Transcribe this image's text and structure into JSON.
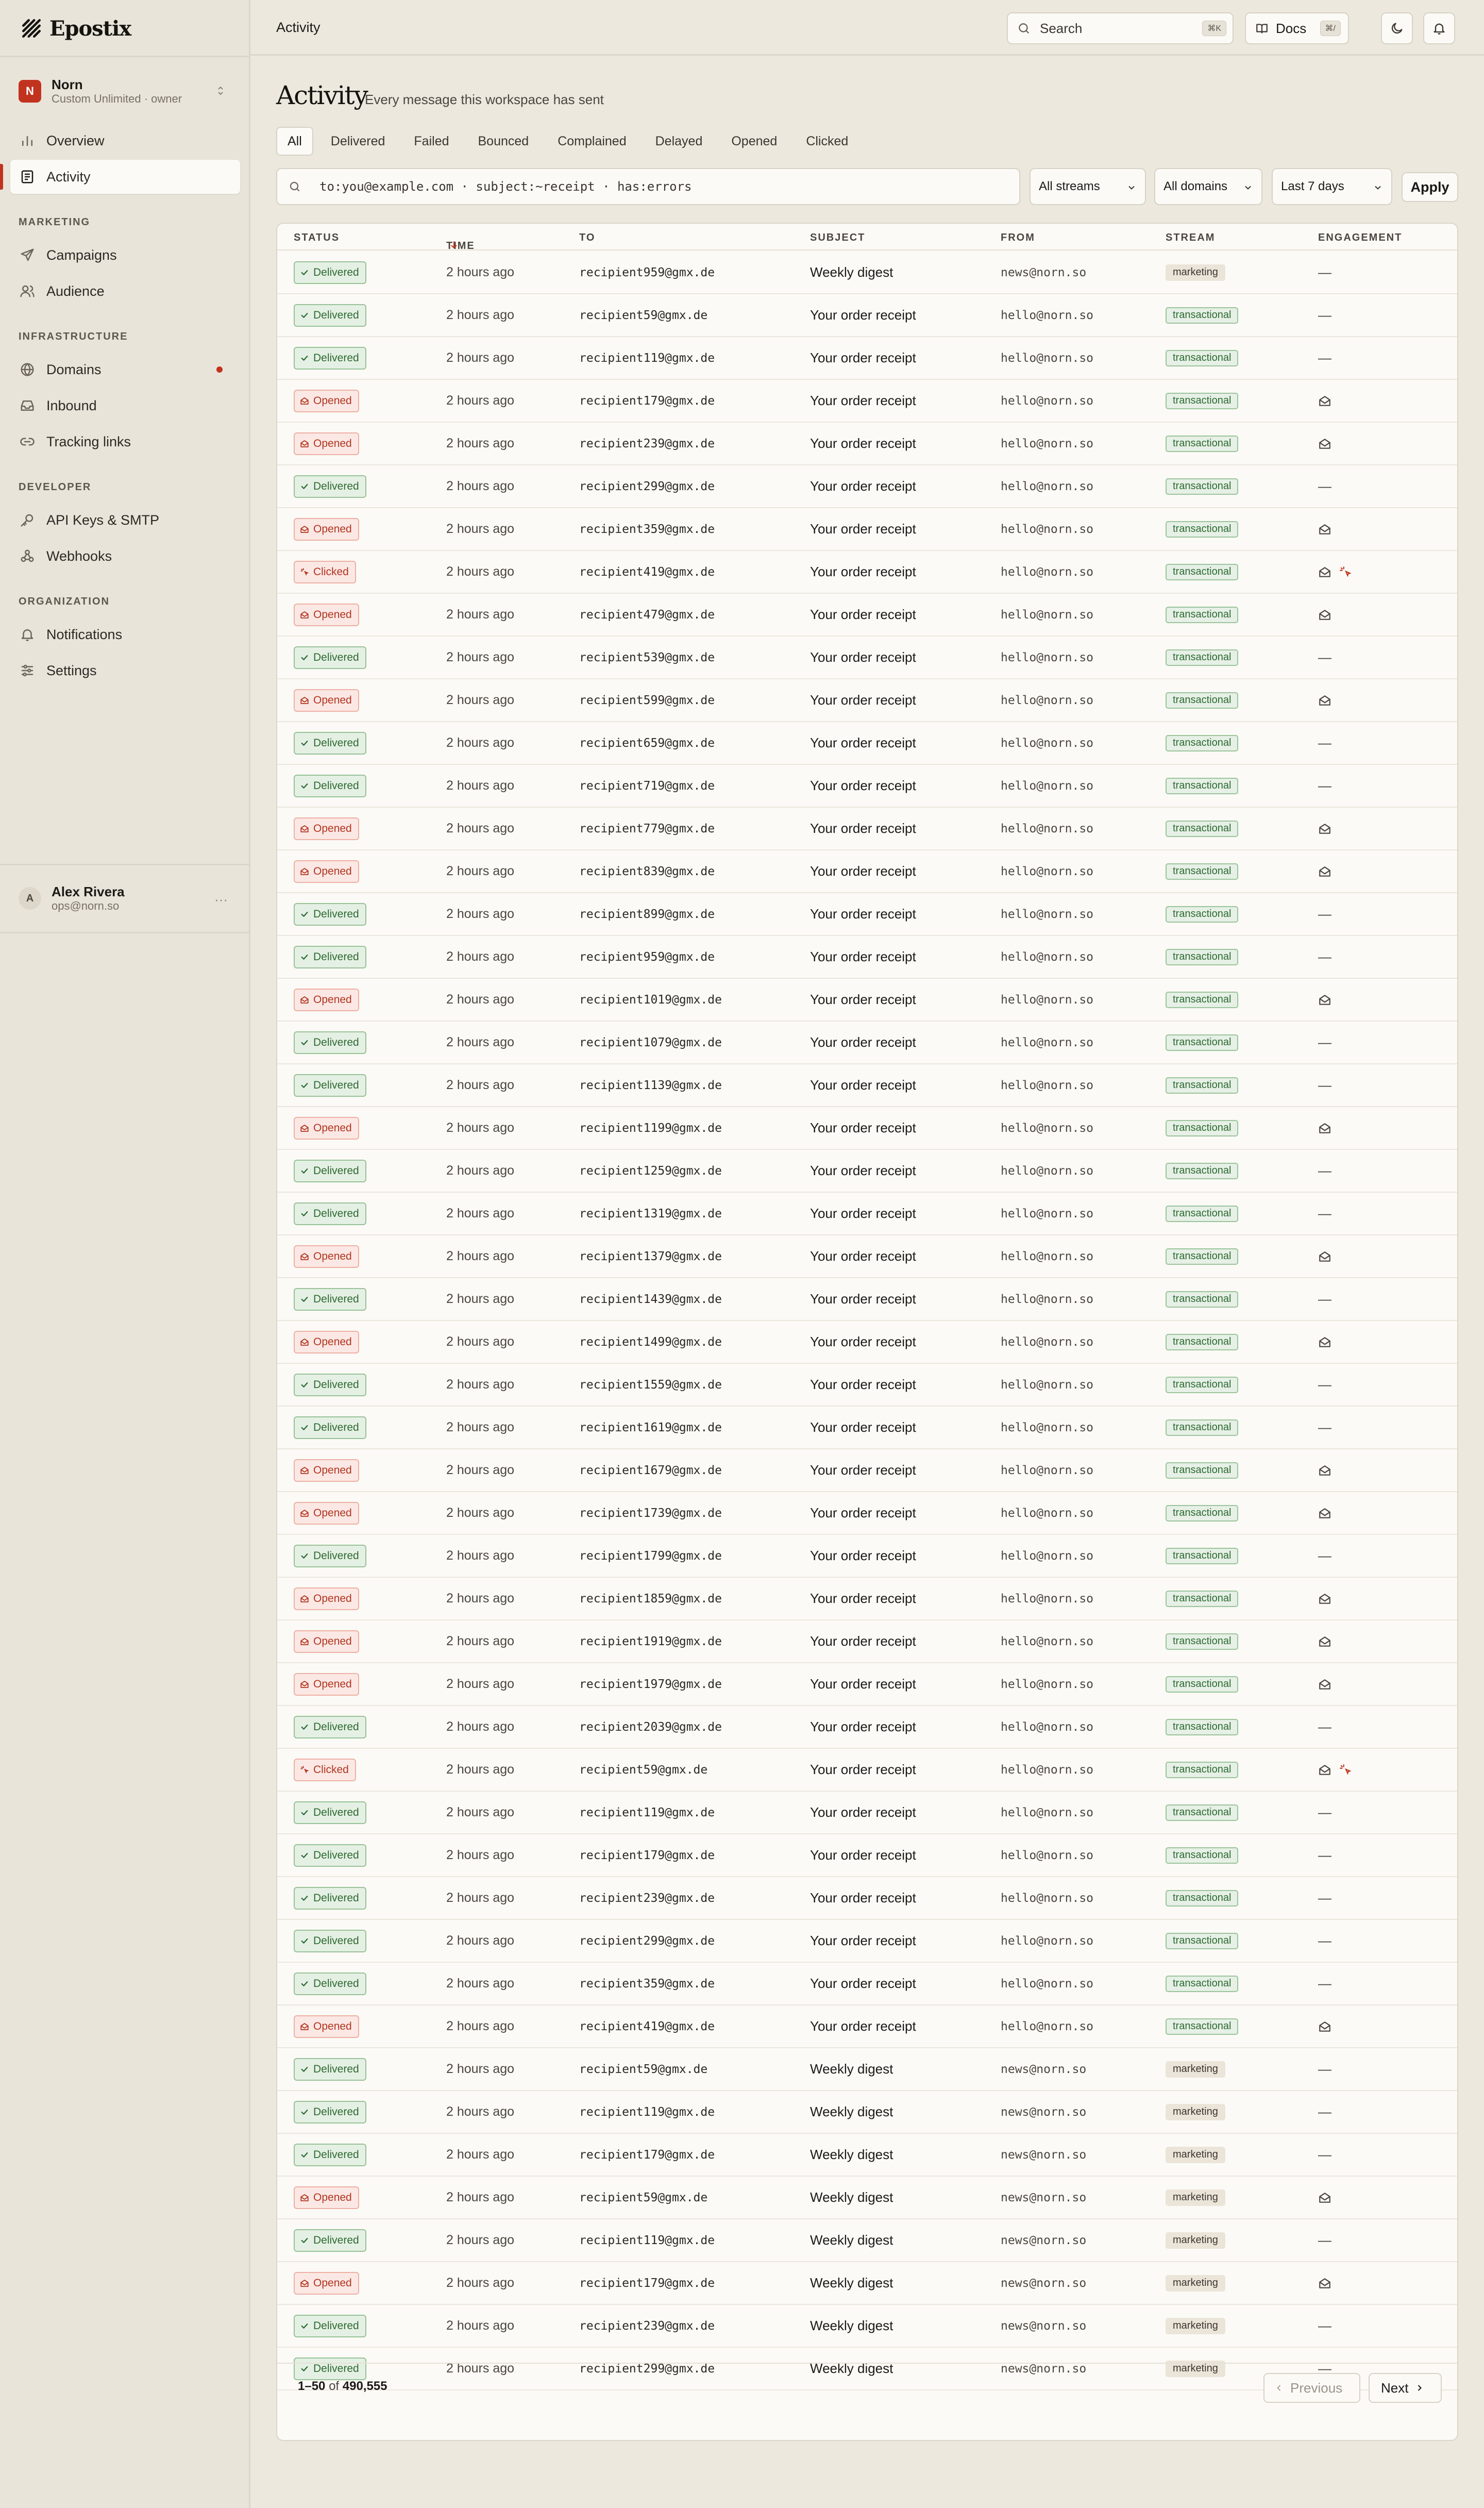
{
  "app": {
    "name": "Epostix"
  },
  "workspace": {
    "avatar": "N",
    "name": "Norn",
    "plan": "Custom Unlimited · owner"
  },
  "nav": {
    "overview": "Overview",
    "activity": "Activity",
    "marketing_title": "MARKETING",
    "campaigns": "Campaigns",
    "audience": "Audience",
    "infra_title": "INFRASTRUCTURE",
    "domains": "Domains",
    "inbound": "Inbound",
    "tracking": "Tracking links",
    "dev_title": "DEVELOPER",
    "apikeys": "API Keys & SMTP",
    "webhooks": "Webhooks",
    "org_title": "ORGANIZATION",
    "notifications": "Notifications",
    "settings": "Settings"
  },
  "user": {
    "avatar": "A",
    "name": "Alex Rivera",
    "email": "ops@norn.so",
    "more": "···"
  },
  "topbar": {
    "title": "Activity",
    "search_placeholder": "Search",
    "search_kbd": "⌘K",
    "docs_label": "Docs",
    "docs_kbd": "⌘/"
  },
  "page": {
    "title": "Activity",
    "subtitle": "Every message this workspace has sent"
  },
  "tabs": [
    "All",
    "Delivered",
    "Failed",
    "Bounced",
    "Complained",
    "Delayed",
    "Opened",
    "Clicked"
  ],
  "filter": {
    "query": "to:you@example.com · subject:~receipt · has:errors",
    "streams": "All streams",
    "domains": "All domains",
    "range": "Last 7 days",
    "apply": "Apply"
  },
  "table": {
    "headers": {
      "status": "STATUS",
      "time": "TIME",
      "to": "TO",
      "subject": "SUBJECT",
      "from": "FROM",
      "stream": "STREAM",
      "engagement": "ENGAGEMENT"
    },
    "rows": [
      {
        "status": "Delivered",
        "time": "2 hours ago",
        "to": "recipient959@gmx.de",
        "subject": "Weekly digest",
        "from": "news@norn.so",
        "stream": "marketing"
      },
      {
        "status": "Delivered",
        "time": "2 hours ago",
        "to": "recipient59@gmx.de",
        "subject": "Your order receipt",
        "from": "hello@norn.so",
        "stream": "transactional"
      },
      {
        "status": "Delivered",
        "time": "2 hours ago",
        "to": "recipient119@gmx.de",
        "subject": "Your order receipt",
        "from": "hello@norn.so",
        "stream": "transactional"
      },
      {
        "status": "Opened",
        "time": "2 hours ago",
        "to": "recipient179@gmx.de",
        "subject": "Your order receipt",
        "from": "hello@norn.so",
        "stream": "transactional"
      },
      {
        "status": "Opened",
        "time": "2 hours ago",
        "to": "recipient239@gmx.de",
        "subject": "Your order receipt",
        "from": "hello@norn.so",
        "stream": "transactional"
      },
      {
        "status": "Delivered",
        "time": "2 hours ago",
        "to": "recipient299@gmx.de",
        "subject": "Your order receipt",
        "from": "hello@norn.so",
        "stream": "transactional"
      },
      {
        "status": "Opened",
        "time": "2 hours ago",
        "to": "recipient359@gmx.de",
        "subject": "Your order receipt",
        "from": "hello@norn.so",
        "stream": "transactional"
      },
      {
        "status": "Clicked",
        "time": "2 hours ago",
        "to": "recipient419@gmx.de",
        "subject": "Your order receipt",
        "from": "hello@norn.so",
        "stream": "transactional"
      },
      {
        "status": "Opened",
        "time": "2 hours ago",
        "to": "recipient479@gmx.de",
        "subject": "Your order receipt",
        "from": "hello@norn.so",
        "stream": "transactional"
      },
      {
        "status": "Delivered",
        "time": "2 hours ago",
        "to": "recipient539@gmx.de",
        "subject": "Your order receipt",
        "from": "hello@norn.so",
        "stream": "transactional"
      },
      {
        "status": "Opened",
        "time": "2 hours ago",
        "to": "recipient599@gmx.de",
        "subject": "Your order receipt",
        "from": "hello@norn.so",
        "stream": "transactional"
      },
      {
        "status": "Delivered",
        "time": "2 hours ago",
        "to": "recipient659@gmx.de",
        "subject": "Your order receipt",
        "from": "hello@norn.so",
        "stream": "transactional"
      },
      {
        "status": "Delivered",
        "time": "2 hours ago",
        "to": "recipient719@gmx.de",
        "subject": "Your order receipt",
        "from": "hello@norn.so",
        "stream": "transactional"
      },
      {
        "status": "Opened",
        "time": "2 hours ago",
        "to": "recipient779@gmx.de",
        "subject": "Your order receipt",
        "from": "hello@norn.so",
        "stream": "transactional"
      },
      {
        "status": "Opened",
        "time": "2 hours ago",
        "to": "recipient839@gmx.de",
        "subject": "Your order receipt",
        "from": "hello@norn.so",
        "stream": "transactional"
      },
      {
        "status": "Delivered",
        "time": "2 hours ago",
        "to": "recipient899@gmx.de",
        "subject": "Your order receipt",
        "from": "hello@norn.so",
        "stream": "transactional"
      },
      {
        "status": "Delivered",
        "time": "2 hours ago",
        "to": "recipient959@gmx.de",
        "subject": "Your order receipt",
        "from": "hello@norn.so",
        "stream": "transactional"
      },
      {
        "status": "Opened",
        "time": "2 hours ago",
        "to": "recipient1019@gmx.de",
        "subject": "Your order receipt",
        "from": "hello@norn.so",
        "stream": "transactional"
      },
      {
        "status": "Delivered",
        "time": "2 hours ago",
        "to": "recipient1079@gmx.de",
        "subject": "Your order receipt",
        "from": "hello@norn.so",
        "stream": "transactional"
      },
      {
        "status": "Delivered",
        "time": "2 hours ago",
        "to": "recipient1139@gmx.de",
        "subject": "Your order receipt",
        "from": "hello@norn.so",
        "stream": "transactional"
      },
      {
        "status": "Opened",
        "time": "2 hours ago",
        "to": "recipient1199@gmx.de",
        "subject": "Your order receipt",
        "from": "hello@norn.so",
        "stream": "transactional"
      },
      {
        "status": "Delivered",
        "time": "2 hours ago",
        "to": "recipient1259@gmx.de",
        "subject": "Your order receipt",
        "from": "hello@norn.so",
        "stream": "transactional"
      },
      {
        "status": "Delivered",
        "time": "2 hours ago",
        "to": "recipient1319@gmx.de",
        "subject": "Your order receipt",
        "from": "hello@norn.so",
        "stream": "transactional"
      },
      {
        "status": "Opened",
        "time": "2 hours ago",
        "to": "recipient1379@gmx.de",
        "subject": "Your order receipt",
        "from": "hello@norn.so",
        "stream": "transactional"
      },
      {
        "status": "Delivered",
        "time": "2 hours ago",
        "to": "recipient1439@gmx.de",
        "subject": "Your order receipt",
        "from": "hello@norn.so",
        "stream": "transactional"
      },
      {
        "status": "Opened",
        "time": "2 hours ago",
        "to": "recipient1499@gmx.de",
        "subject": "Your order receipt",
        "from": "hello@norn.so",
        "stream": "transactional"
      },
      {
        "status": "Delivered",
        "time": "2 hours ago",
        "to": "recipient1559@gmx.de",
        "subject": "Your order receipt",
        "from": "hello@norn.so",
        "stream": "transactional"
      },
      {
        "status": "Delivered",
        "time": "2 hours ago",
        "to": "recipient1619@gmx.de",
        "subject": "Your order receipt",
        "from": "hello@norn.so",
        "stream": "transactional"
      },
      {
        "status": "Opened",
        "time": "2 hours ago",
        "to": "recipient1679@gmx.de",
        "subject": "Your order receipt",
        "from": "hello@norn.so",
        "stream": "transactional"
      },
      {
        "status": "Opened",
        "time": "2 hours ago",
        "to": "recipient1739@gmx.de",
        "subject": "Your order receipt",
        "from": "hello@norn.so",
        "stream": "transactional"
      },
      {
        "status": "Delivered",
        "time": "2 hours ago",
        "to": "recipient1799@gmx.de",
        "subject": "Your order receipt",
        "from": "hello@norn.so",
        "stream": "transactional"
      },
      {
        "status": "Opened",
        "time": "2 hours ago",
        "to": "recipient1859@gmx.de",
        "subject": "Your order receipt",
        "from": "hello@norn.so",
        "stream": "transactional"
      },
      {
        "status": "Opened",
        "time": "2 hours ago",
        "to": "recipient1919@gmx.de",
        "subject": "Your order receipt",
        "from": "hello@norn.so",
        "stream": "transactional"
      },
      {
        "status": "Opened",
        "time": "2 hours ago",
        "to": "recipient1979@gmx.de",
        "subject": "Your order receipt",
        "from": "hello@norn.so",
        "stream": "transactional"
      },
      {
        "status": "Delivered",
        "time": "2 hours ago",
        "to": "recipient2039@gmx.de",
        "subject": "Your order receipt",
        "from": "hello@norn.so",
        "stream": "transactional"
      },
      {
        "status": "Clicked",
        "time": "2 hours ago",
        "to": "recipient59@gmx.de",
        "subject": "Your order receipt",
        "from": "hello@norn.so",
        "stream": "transactional"
      },
      {
        "status": "Delivered",
        "time": "2 hours ago",
        "to": "recipient119@gmx.de",
        "subject": "Your order receipt",
        "from": "hello@norn.so",
        "stream": "transactional"
      },
      {
        "status": "Delivered",
        "time": "2 hours ago",
        "to": "recipient179@gmx.de",
        "subject": "Your order receipt",
        "from": "hello@norn.so",
        "stream": "transactional"
      },
      {
        "status": "Delivered",
        "time": "2 hours ago",
        "to": "recipient239@gmx.de",
        "subject": "Your order receipt",
        "from": "hello@norn.so",
        "stream": "transactional"
      },
      {
        "status": "Delivered",
        "time": "2 hours ago",
        "to": "recipient299@gmx.de",
        "subject": "Your order receipt",
        "from": "hello@norn.so",
        "stream": "transactional"
      },
      {
        "status": "Delivered",
        "time": "2 hours ago",
        "to": "recipient359@gmx.de",
        "subject": "Your order receipt",
        "from": "hello@norn.so",
        "stream": "transactional"
      },
      {
        "status": "Opened",
        "time": "2 hours ago",
        "to": "recipient419@gmx.de",
        "subject": "Your order receipt",
        "from": "hello@norn.so",
        "stream": "transactional"
      },
      {
        "status": "Delivered",
        "time": "2 hours ago",
        "to": "recipient59@gmx.de",
        "subject": "Weekly digest",
        "from": "news@norn.so",
        "stream": "marketing"
      },
      {
        "status": "Delivered",
        "time": "2 hours ago",
        "to": "recipient119@gmx.de",
        "subject": "Weekly digest",
        "from": "news@norn.so",
        "stream": "marketing"
      },
      {
        "status": "Delivered",
        "time": "2 hours ago",
        "to": "recipient179@gmx.de",
        "subject": "Weekly digest",
        "from": "news@norn.so",
        "stream": "marketing"
      },
      {
        "status": "Opened",
        "time": "2 hours ago",
        "to": "recipient59@gmx.de",
        "subject": "Weekly digest",
        "from": "news@norn.so",
        "stream": "marketing"
      },
      {
        "status": "Delivered",
        "time": "2 hours ago",
        "to": "recipient119@gmx.de",
        "subject": "Weekly digest",
        "from": "news@norn.so",
        "stream": "marketing"
      },
      {
        "status": "Opened",
        "time": "2 hours ago",
        "to": "recipient179@gmx.de",
        "subject": "Weekly digest",
        "from": "news@norn.so",
        "stream": "marketing"
      },
      {
        "status": "Delivered",
        "time": "2 hours ago",
        "to": "recipient239@gmx.de",
        "subject": "Weekly digest",
        "from": "news@norn.so",
        "stream": "marketing"
      },
      {
        "status": "Delivered",
        "time": "2 hours ago",
        "to": "recipient299@gmx.de",
        "subject": "Weekly digest",
        "from": "news@norn.so",
        "stream": "marketing"
      }
    ]
  },
  "pager": {
    "range": "1–50",
    "of": "of",
    "total": "490,555",
    "prev": "Previous",
    "next": "Next"
  }
}
